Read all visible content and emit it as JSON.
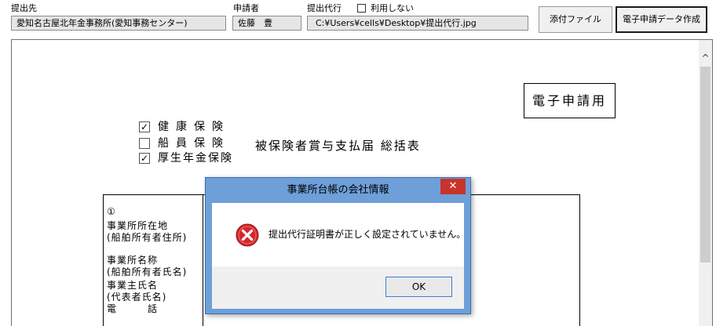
{
  "header": {
    "destination_label": "提出先",
    "destination_value": "愛知名古屋北年金事務所(愛知事務センター)",
    "applicant_label": "申請者",
    "applicant_value": "佐藤　豊",
    "proxy_label": "提出代行",
    "proxy_checkbox_label": "利用しない",
    "proxy_path": "C:¥Users¥cells¥Desktop¥提出代行.jpg",
    "attach_button": "添付ファイル",
    "create_button": "電子申請データ作成"
  },
  "document": {
    "stamp": "電子申請用",
    "insurance": [
      {
        "label": "健康保険",
        "checked": true,
        "mark": "✓"
      },
      {
        "label": "船員保険",
        "checked": false,
        "mark": ""
      },
      {
        "label": "厚生年金保険",
        "checked": true,
        "mark": "✓"
      }
    ],
    "form_title": "被保険者賞与支払届 総括表",
    "table": {
      "marker": "①",
      "address_label": "事業所所在地\n(船舶所有者住所)",
      "name_label": "事業所名称\n(船舶所有者氏名)",
      "owner_label": "事業主氏名\n(代表者氏名)",
      "phone_label": "電　　　話"
    }
  },
  "dialog": {
    "title": "事業所台帳の会社情報",
    "message": "提出代行証明書が正しく設定されていません。",
    "ok_label": "OK",
    "close_glyph": "✕",
    "icon": "error-icon"
  },
  "scrollbar": {
    "up_glyph": "^"
  }
}
